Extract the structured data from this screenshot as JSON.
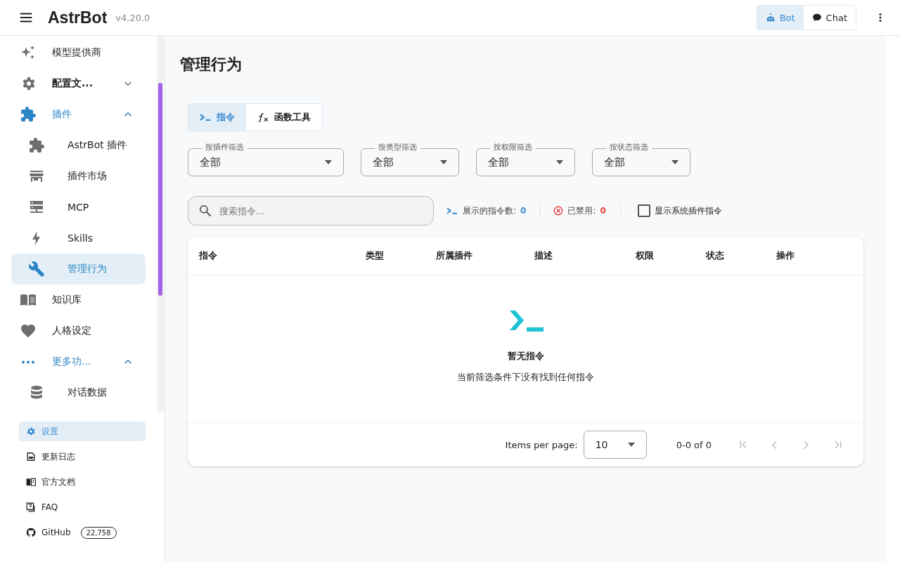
{
  "header": {
    "title": "AstrBot",
    "version": "v4.20.0",
    "modes": [
      {
        "label": "Bot",
        "selected": true
      },
      {
        "label": "Chat",
        "selected": false
      }
    ]
  },
  "sidebar": {
    "items": [
      {
        "label": "模型提供商",
        "selected": false
      },
      {
        "label": "配置文...",
        "selected": false,
        "expanded": false
      },
      {
        "label": "插件",
        "selected": false,
        "expanded": true,
        "children": [
          {
            "label": "AstrBot 插件",
            "selected": false
          },
          {
            "label": "插件市场",
            "selected": false
          },
          {
            "label": "MCP",
            "selected": false
          },
          {
            "label": "Skills",
            "selected": false
          },
          {
            "label": "管理行为",
            "selected": true
          }
        ]
      },
      {
        "label": "知识库",
        "selected": false
      },
      {
        "label": "人格设定",
        "selected": false
      },
      {
        "label": "更多功...",
        "selected": false,
        "expanded": true,
        "children": [
          {
            "label": "对话数据",
            "selected": false
          }
        ]
      }
    ],
    "footer": [
      {
        "label": "设置",
        "selected": true
      },
      {
        "label": "更新日志",
        "selected": false
      },
      {
        "label": "官方文档",
        "selected": false
      },
      {
        "label": "FAQ",
        "selected": false
      },
      {
        "label": "GitHub",
        "selected": false,
        "badge": "22,758"
      }
    ]
  },
  "page": {
    "title": "管理行为",
    "tabs": [
      {
        "label": "指令",
        "selected": true
      },
      {
        "label": "函数工具",
        "selected": false
      }
    ],
    "filters": [
      {
        "label": "按插件筛选",
        "value": "全部"
      },
      {
        "label": "按类型筛选",
        "value": "全部"
      },
      {
        "label": "按权限筛选",
        "value": "全部"
      },
      {
        "label": "按状态筛选",
        "value": "全部"
      }
    ],
    "search": {
      "placeholder": "搜索指令..."
    },
    "stats": [
      {
        "label": "展示的指令数:",
        "value": "0"
      },
      {
        "label": "已禁用:",
        "value": "0"
      }
    ],
    "system_toggle": {
      "label": "显示系统插件指令",
      "checked": false
    },
    "table": {
      "columns": [
        "指令",
        "类型",
        "所属插件",
        "描述",
        "权限",
        "状态",
        "操作"
      ],
      "empty": {
        "title": "暂无指令",
        "message": "当前筛选条件下没有找到任何指令"
      },
      "pagination": {
        "label": "Items per page:",
        "per_page": "10",
        "range": "0-0 of 0"
      }
    }
  }
}
